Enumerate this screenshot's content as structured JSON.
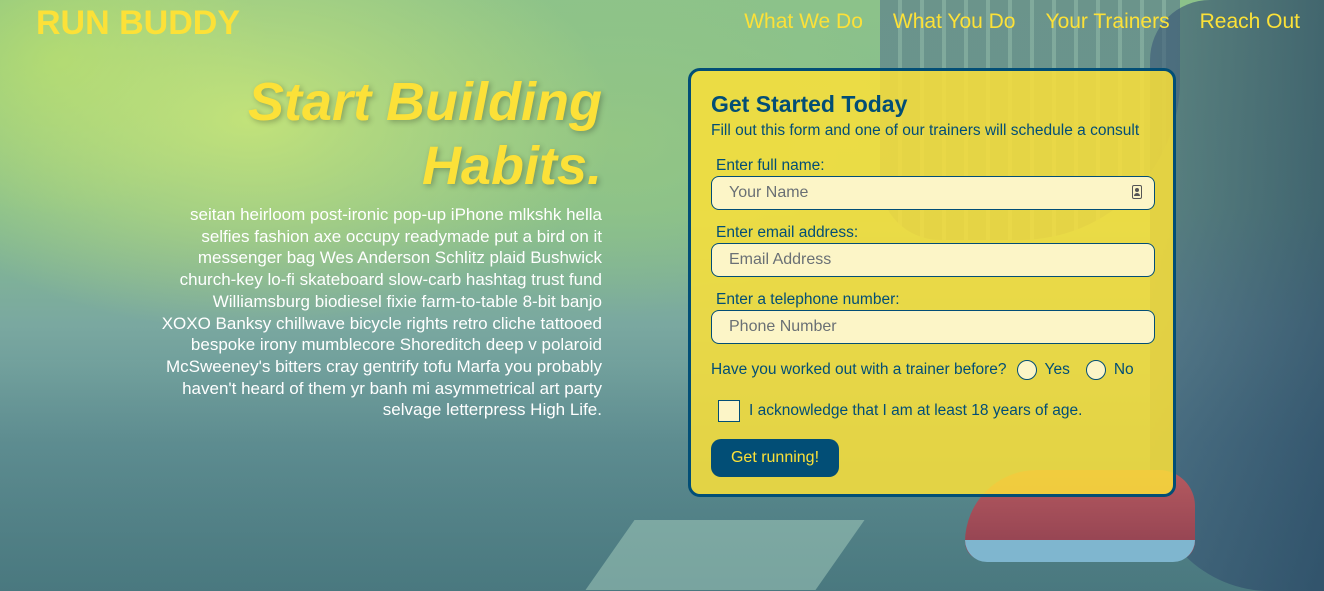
{
  "header": {
    "brand": "RUN BUDDY",
    "nav": [
      "What We Do",
      "What You Do",
      "Your Trainers",
      "Reach Out"
    ]
  },
  "hero": {
    "heading_line1": "Start Building",
    "heading_line2": "Habits.",
    "body": "seitan heirloom post-ironic pop-up iPhone mlkshk hella selfies fashion axe occupy readymade put a bird on it messenger bag Wes Anderson Schlitz plaid Bushwick church-key lo-fi skateboard slow-carb hashtag trust fund Williamsburg biodiesel fixie farm-to-table 8-bit banjo XOXO Banksy chillwave bicycle rights retro cliche tattooed bespoke irony mumblecore Shoreditch deep v polaroid McSweeney's bitters cray gentrify tofu Marfa you probably haven't heard of them yr banh mi asymmetrical art party selvage letterpress High Life."
  },
  "form": {
    "title": "Get Started Today",
    "subtitle": "Fill out this form and one of our trainers will schedule a consult",
    "name_label": "Enter full name:",
    "name_placeholder": "Your Name",
    "email_label": "Enter email address:",
    "email_placeholder": "Email Address",
    "phone_label": "Enter a telephone number:",
    "phone_placeholder": "Phone Number",
    "trainer_question": "Have you worked out with a trainer before?",
    "yes_label": "Yes",
    "no_label": "No",
    "age_ack": "I acknowledge that I am at least 18 years of age.",
    "submit_label": "Get running!"
  },
  "colors": {
    "accent": "#fce138",
    "primary": "#024e76"
  }
}
